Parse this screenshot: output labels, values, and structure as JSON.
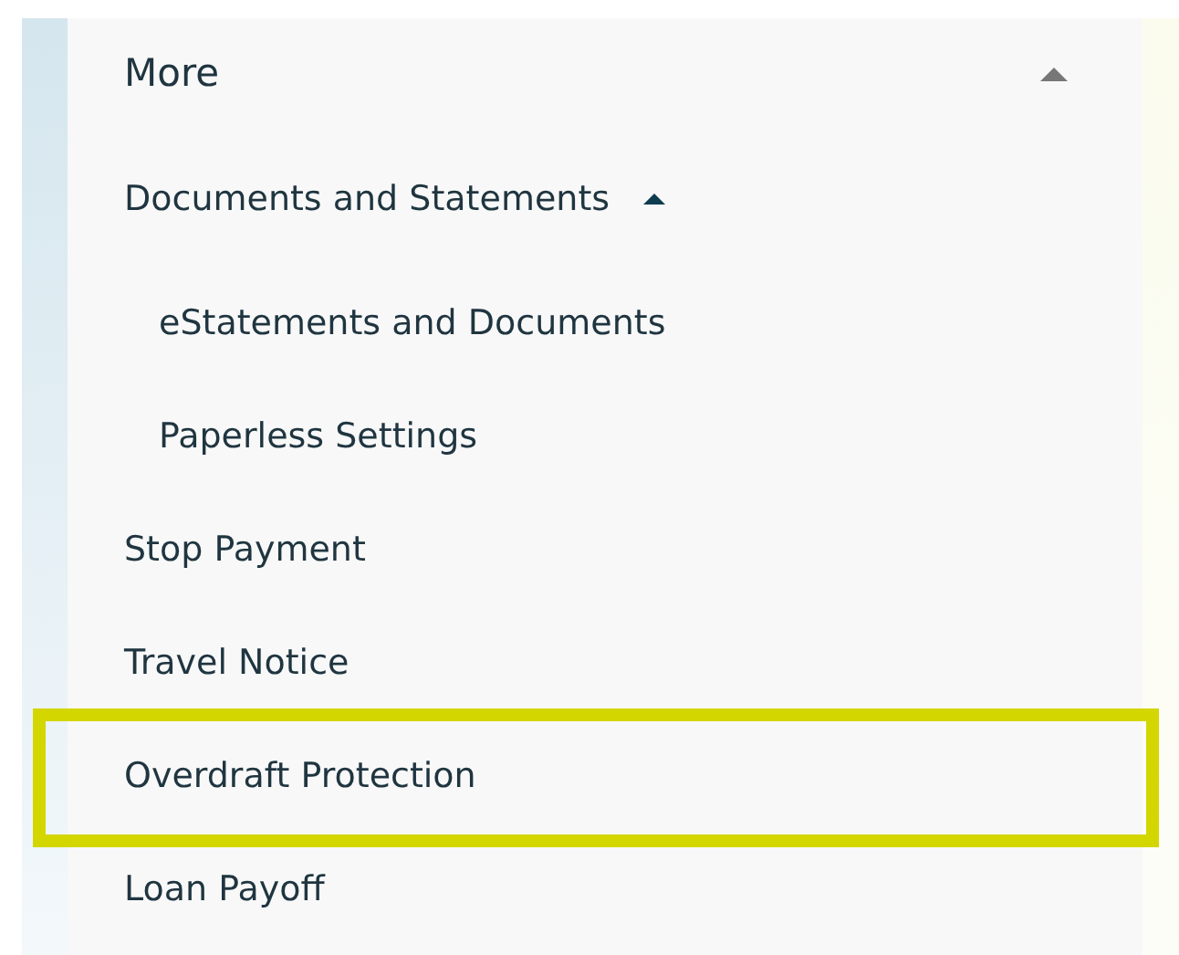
{
  "menu": {
    "title": "More",
    "expanded": true,
    "items": [
      {
        "label": "Documents and Statements",
        "kind": "group",
        "expanded": true,
        "highlighted": false,
        "children": [
          {
            "label": "eStatements and Documents",
            "highlighted": false
          },
          {
            "label": "Paperless Settings",
            "highlighted": false
          }
        ]
      },
      {
        "label": "Stop Payment",
        "kind": "link",
        "highlighted": false
      },
      {
        "label": "Travel Notice",
        "kind": "link",
        "highlighted": false
      },
      {
        "label": "Overdraft Protection",
        "kind": "link",
        "highlighted": true
      },
      {
        "label": "Loan Payoff",
        "kind": "link",
        "highlighted": false
      }
    ]
  }
}
